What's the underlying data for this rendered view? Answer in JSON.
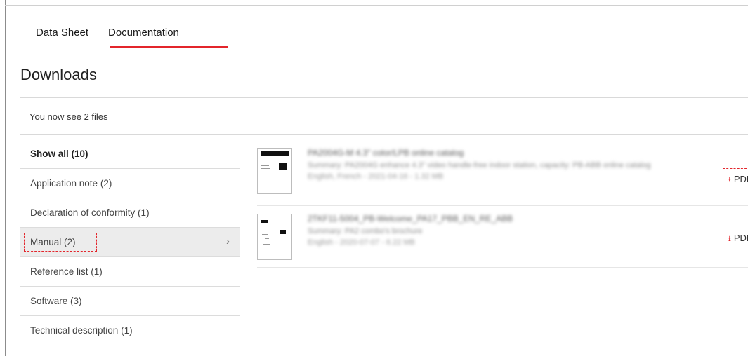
{
  "tabs": [
    {
      "label": "Data Sheet"
    },
    {
      "label": "Documentation"
    }
  ],
  "downloads": {
    "title": "Downloads",
    "count_text": "You now see 2 files"
  },
  "filters": [
    {
      "label": "Show all (10)"
    },
    {
      "label": "Application note (2)"
    },
    {
      "label": "Declaration of conformity (1)"
    },
    {
      "label": "Manual (2)"
    },
    {
      "label": "Reference list (1)"
    },
    {
      "label": "Software (3)"
    },
    {
      "label": "Technical description (1)"
    }
  ],
  "chevron": "›",
  "files": [
    {
      "title": "PA2004G-M 4.3\" color/LPB online catalog",
      "summary": "Summary: PA2004G enhance 4.3\" video handle-free indoor station, capacity: PB-ABB online catalog",
      "meta": "English, French - 2021-04-16 - 1.32 MB",
      "download_label": "PDF"
    },
    {
      "title": "2TKF11-5004_PB-Welcome_PA17_PBB_EN_RE_ABB",
      "summary": "Summary: PA2 combo's brochure",
      "meta": "English - 2020-07-07 - 6.22 MB",
      "download_label": "PDF"
    }
  ],
  "icons": {
    "download": "download-arrow-icon"
  },
  "colors": {
    "accent": "#e3252b"
  }
}
